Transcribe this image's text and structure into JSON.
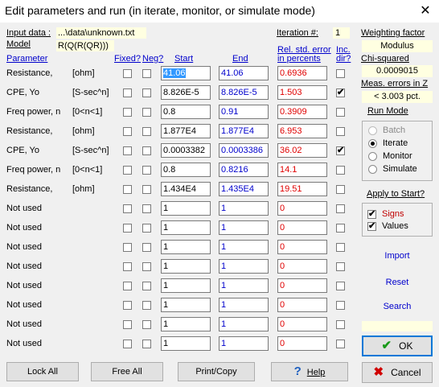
{
  "window": {
    "title": "Edit parameters and run (in iterate, monitor, or simulate mode)",
    "close_glyph": "✕"
  },
  "header": {
    "input_data_label": "Input data :",
    "input_data_value": "...\\data\\unknown.txt",
    "model_label": "Model",
    "model_value": "R(Q(R(QR)))",
    "iteration_label": "Iteration #:",
    "iteration_value": "1"
  },
  "columns": {
    "parameter": "Parameter",
    "fixed": "Fixed?",
    "neg": "Neg?",
    "start": "Start",
    "end": "End",
    "rel_err_1": "Rel. std. error",
    "rel_err_2": "in percents",
    "inc_1": "Inc.",
    "inc_2": "dir?"
  },
  "rows": [
    {
      "name": "Resistance,",
      "unit": "[ohm]",
      "start": "41.06",
      "end": "41.06",
      "err": "0.6936",
      "inc": false
    },
    {
      "name": "CPE,  Yo",
      "unit": "[S-sec^n]",
      "start": "8.826E-5",
      "end": "8.826E-5",
      "err": "1.503",
      "inc": true
    },
    {
      "name": "Freq power, n",
      "unit": "[0<n<1]",
      "start": "0.8",
      "end": "0.91",
      "err": "0.3909",
      "inc": false
    },
    {
      "name": "Resistance,",
      "unit": "[ohm]",
      "start": "1.877E4",
      "end": "1.877E4",
      "err": "6.953",
      "inc": false
    },
    {
      "name": "CPE,  Yo",
      "unit": "[S-sec^n]",
      "start": "0.0003382",
      "end": "0.0003386",
      "err": "36.02",
      "inc": true
    },
    {
      "name": "Freq power, n",
      "unit": "[0<n<1]",
      "start": "0.8",
      "end": "0.8216",
      "err": "14.1",
      "inc": false
    },
    {
      "name": "Resistance,",
      "unit": "[ohm]",
      "start": "1.434E4",
      "end": "1.435E4",
      "err": "19.51",
      "inc": false
    },
    {
      "name": "Not used",
      "unit": "",
      "start": "1",
      "end": "1",
      "err": "0",
      "inc": false
    },
    {
      "name": "Not used",
      "unit": "",
      "start": "1",
      "end": "1",
      "err": "0",
      "inc": false
    },
    {
      "name": "Not used",
      "unit": "",
      "start": "1",
      "end": "1",
      "err": "0",
      "inc": false
    },
    {
      "name": "Not used",
      "unit": "",
      "start": "1",
      "end": "1",
      "err": "0",
      "inc": false
    },
    {
      "name": "Not used",
      "unit": "",
      "start": "1",
      "end": "1",
      "err": "0",
      "inc": false
    },
    {
      "name": "Not used",
      "unit": "",
      "start": "1",
      "end": "1",
      "err": "0",
      "inc": false
    },
    {
      "name": "Not used",
      "unit": "",
      "start": "1",
      "end": "1",
      "err": "0",
      "inc": false
    },
    {
      "name": "Not used",
      "unit": "",
      "start": "1",
      "end": "1",
      "err": "0",
      "inc": false
    }
  ],
  "right_panel": {
    "weighting_label": "Weighting factor",
    "weighting_value": "Modulus",
    "chi_label": "Chi-squared",
    "chi_value": "0.0009015",
    "meas_label": "Meas. errors in Z",
    "meas_value": "< 3.003 pct.",
    "run_mode_label": "Run Mode",
    "modes": [
      {
        "label": "Batch",
        "selected": false,
        "disabled": true
      },
      {
        "label": "Iterate",
        "selected": true,
        "disabled": false
      },
      {
        "label": "Monitor",
        "selected": false,
        "disabled": false
      },
      {
        "label": "Simulate",
        "selected": false,
        "disabled": false
      }
    ],
    "apply_label": "Apply to Start?",
    "signs_label": "Signs",
    "values_label": "Values",
    "signs_checked": true,
    "values_checked": true,
    "import_label": "Import",
    "reset_label": "Reset",
    "search_label": "Search",
    "ok_label": "OK",
    "cancel_label": "Cancel"
  },
  "footer": {
    "lock_all": "Lock All",
    "free_all": "Free All",
    "print_copy": "Print/Copy",
    "help": "Help"
  },
  "colors": {
    "accent_blue": "#0000cc",
    "error_red": "#e00000",
    "info_yellow": "#ffffe1",
    "selection": "#3399ff"
  }
}
